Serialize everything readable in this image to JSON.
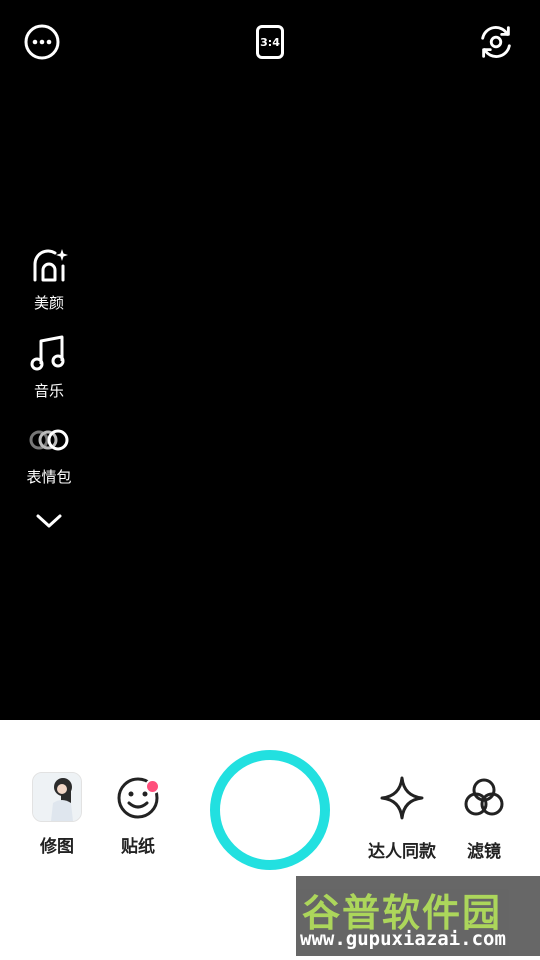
{
  "top_bar": {
    "more_icon": "more-horizontal-icon",
    "ratio_label": "3:4",
    "flip_icon": "camera-flip-icon"
  },
  "side_menu": {
    "items": [
      {
        "label": "美颜",
        "icon": "beauty-face-icon"
      },
      {
        "label": "音乐",
        "icon": "music-note-icon"
      },
      {
        "label": "表情包",
        "icon": "emoji-pack-icon"
      }
    ],
    "expand_icon": "chevron-down-icon"
  },
  "bottom_bar": {
    "edit_label": "修图",
    "sticker_label": "贴纸",
    "template_label": "达人同款",
    "filter_label": "滤镜",
    "accent_color": "#22e0e0",
    "badge_color": "#ff4f7b"
  },
  "watermark": {
    "title": "谷普软件园",
    "url": "www.gupuxiazai.com"
  }
}
